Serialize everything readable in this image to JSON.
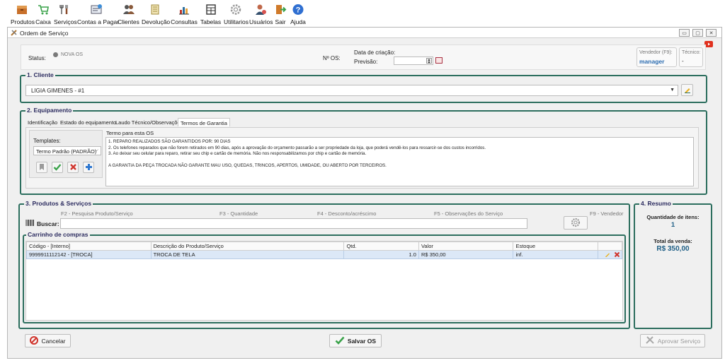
{
  "menu": [
    {
      "label": "Produtos",
      "icon": "products-icon"
    },
    {
      "label": "Caixa",
      "icon": "cart-icon"
    },
    {
      "label": "Serviços",
      "icon": "tools-icon"
    },
    {
      "label": "Contas a Pagar",
      "icon": "bills-icon"
    },
    {
      "label": "Clientes",
      "icon": "clients-icon"
    },
    {
      "label": "Devolução",
      "icon": "return-icon"
    },
    {
      "label": "Consultas",
      "icon": "reports-icon"
    },
    {
      "label": "Tabelas",
      "icon": "tables-icon"
    },
    {
      "label": "Utilitarios",
      "icon": "gear-icon"
    },
    {
      "label": "Usuários",
      "icon": "users-icon"
    },
    {
      "label": "Sair",
      "icon": "exit-icon"
    },
    {
      "label": "Ajuda",
      "icon": "help-icon"
    }
  ],
  "window": {
    "title": "Ordem de Serviço"
  },
  "info": {
    "status_label": "Status:",
    "status_value": "NOVA OS",
    "os_number_label": "Nº OS:",
    "creation_date_label": "Data de criação:",
    "forecast_label": "Previsão:",
    "vendor_label": "Vendedor (F9):",
    "vendor_value": "manager",
    "technician_label": "Técnico:",
    "technician_value": "-"
  },
  "client": {
    "legend": "1. Cliente",
    "value": "LIGIA GIMENES - #1"
  },
  "equipment": {
    "legend": "2. Equipamento",
    "tabs": [
      "Identificação",
      "Estado do equipamento",
      "Laudo Técnico/Observações",
      "Termos de Garantia"
    ],
    "active_tab": "Termos de Garantia",
    "templates_label": "Templates:",
    "template_selected": "Termo Padrão (PADRÃO)",
    "term_label": "Termo para esta OS",
    "term_lines": [
      "1. REPARO REALIZADOS SÃO GARANTIDOS POR: 90 DIAS",
      "2. Os telefones reparados que não forem retirados em 90 dias, após a aprovação do orçamento passarão a ser propriedade da loja, que poderá vendê-los para ressarcir-se dos custos incorridos.",
      "3. Ao deixar seu celular para reparo, retirar seu chip e cartão de memória. Não nos responsabilizamos por chip e cartão de memória.",
      "",
      "A GARANTIA DA PEÇA TROCADA NÃO GARANTE MAU USO, QUEDAS, TRINCOS, APERTOS, UMIDADE, OU ABERTO POR TERCEIROS."
    ]
  },
  "products": {
    "legend": "3. Produtos & Serviços",
    "shortcuts": [
      "F2 - Pesquisa Produto/Serviço",
      "F3 - Quantidade",
      "F4 - Desconto/acréscimo",
      "F5 - Observações do Serviço",
      "F9 - Vendedor"
    ],
    "search_label": "Buscar:",
    "search_value": "",
    "cart_legend": "Carrinho de compras",
    "columns": [
      "Código - [Interno]",
      "Descrição do Produto/Serviço",
      "Qtd.",
      "Valor",
      "Estoque"
    ],
    "rows": [
      {
        "code": "9999911112142 - [TROCA]",
        "description": "TROCA DE TELA",
        "qty": "1.0",
        "value": "R$ 350,00",
        "stock": "inf."
      }
    ]
  },
  "summary": {
    "legend": "4. Resumo",
    "items_label": "Quantidade de itens:",
    "items_value": "1",
    "total_label": "Total da venda:",
    "total_value": "R$ 350,00"
  },
  "footer": {
    "cancel": "Cancelar",
    "save": "Salvar OS",
    "approve": "Aprovar Serviço"
  },
  "colors": {
    "group_border": "#2c6e5e",
    "legend_text": "#2b2b5f",
    "vendor_text": "#2b6cb0",
    "summary_value": "#1f5f86",
    "row_highlight": "#dce8f7"
  }
}
